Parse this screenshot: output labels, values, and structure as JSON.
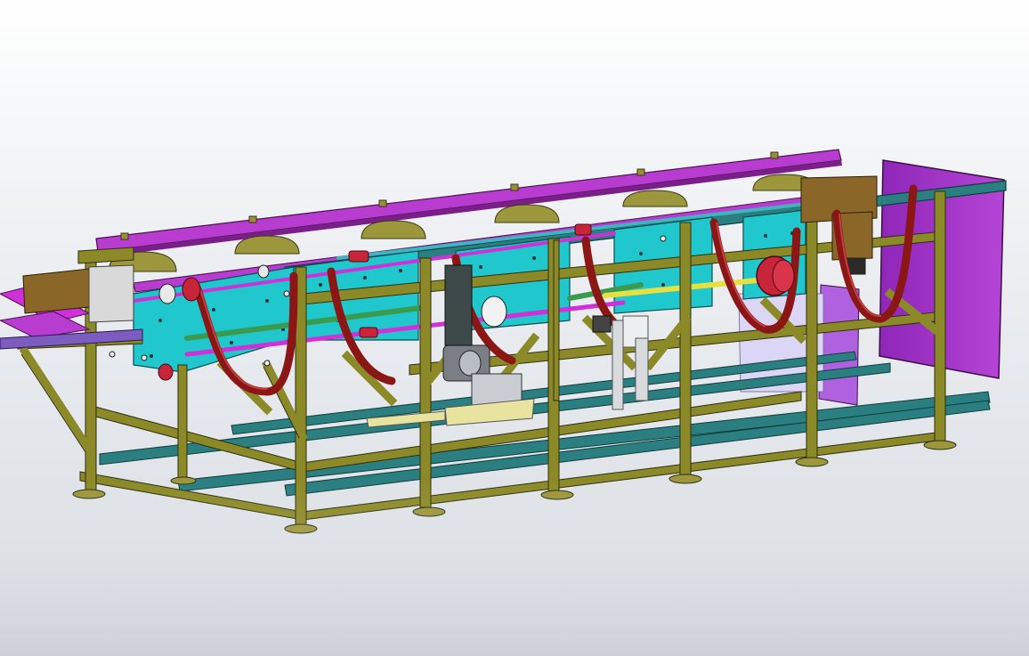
{
  "viewport": {
    "background_top": "#ffffff",
    "background_bottom": "#d7dbe1"
  },
  "model": {
    "colors": {
      "frame": "#8c8a28",
      "frame_edge": "#2e2e10",
      "crossbar": "#2b7f80",
      "top_rail": "#b83cd0",
      "plate": "#20c7cc",
      "belt": "#8a1616",
      "pulley": "#c8243a",
      "rod_green": "#3a9a4e",
      "rod_yellow": "#e8e040",
      "rod_magenta": "#d030d8",
      "panel_violet": "#a437c8",
      "panel_lavender": "#d9c8f4",
      "bracket_brown": "#8a6628",
      "motor_gray": "#7b7f85"
    }
  }
}
